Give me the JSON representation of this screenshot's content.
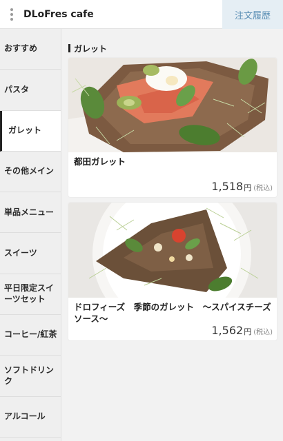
{
  "header": {
    "title": "DLoFres cafe",
    "order_history_label": "注文履歴"
  },
  "sidebar": {
    "items": [
      {
        "label": "おすすめ",
        "active": false
      },
      {
        "label": "パスタ",
        "active": false
      },
      {
        "label": "ガレット",
        "active": true
      },
      {
        "label": "その他メイン",
        "active": false
      },
      {
        "label": "単品メニュー",
        "active": false
      },
      {
        "label": "スイーツ",
        "active": false
      },
      {
        "label": "平日限定スイーツセット",
        "active": false
      },
      {
        "label": "コーヒー/紅茶",
        "active": false
      },
      {
        "label": "ソフトドリンク",
        "active": false
      },
      {
        "label": "アルコール",
        "active": false
      }
    ]
  },
  "main": {
    "section_title": "ガレット",
    "items": [
      {
        "name": "都田ガレット",
        "price": "1,518",
        "currency": "円",
        "tax_note": "(税込)"
      },
      {
        "name": "ドロフィーズ　季節のガレット　〜スパイスチーズソース〜",
        "price": "1,562",
        "currency": "円",
        "tax_note": "(税込)"
      }
    ]
  },
  "colors": {
    "accent": "#5b8fb5",
    "history_bg": "#e5eef4",
    "sidebar_bg": "#efefef"
  }
}
